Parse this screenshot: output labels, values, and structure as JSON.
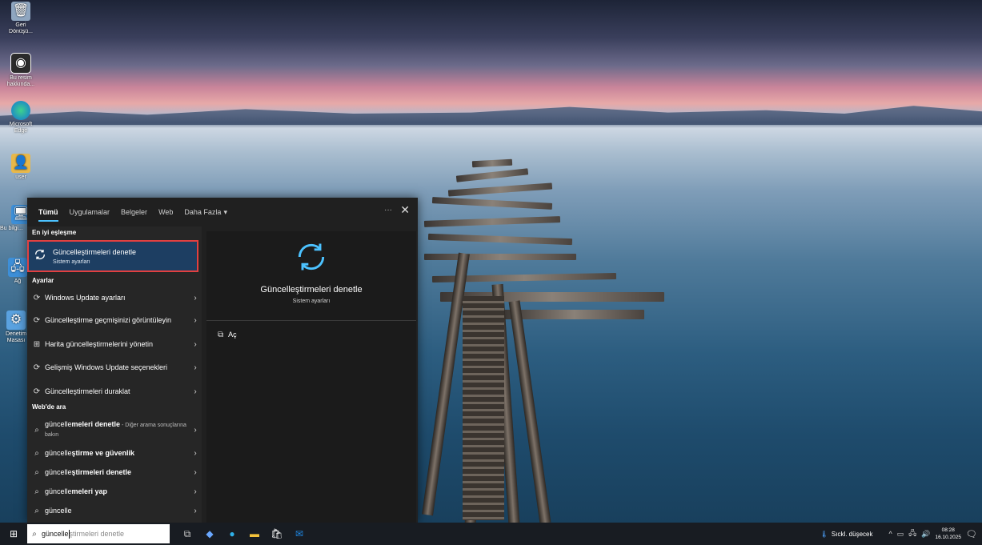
{
  "desktop": {
    "icons": [
      {
        "label": "Geri Dönüşü..."
      },
      {
        "label": "Bu resim hakkında..."
      },
      {
        "label": "Microsoft Edge"
      },
      {
        "label": "user"
      },
      {
        "label": "Bu bilgi..."
      },
      {
        "label": "Ağ"
      },
      {
        "label": "Denetim Masası"
      }
    ]
  },
  "search_panel": {
    "tabs": [
      "Tümü",
      "Uygulamalar",
      "Belgeler",
      "Web",
      "Daha Fazla"
    ],
    "more_options": "···",
    "close": "✕",
    "best_match_heading": "En iyi eşleşme",
    "best_match": {
      "title": "Güncelleştirmeleri denetle",
      "subtitle": "Sistem ayarları"
    },
    "settings_heading": "Ayarlar",
    "settings_items": [
      {
        "label": "Windows Update ayarları"
      },
      {
        "label": "Güncelleştirme geçmişinizi görüntüleyin"
      },
      {
        "label": "Harita güncelleştirmelerini yönetin"
      },
      {
        "label": "Gelişmiş Windows Update seçenekleri"
      },
      {
        "label": "Güncelleştirmeleri duraklat"
      }
    ],
    "web_heading": "Web'de ara",
    "web_items": [
      {
        "prefix": "güncelle",
        "bold": "meleri denetle",
        "suffix": " - Diğer arama sonuçlarına bakın"
      },
      {
        "prefix": "güncelle",
        "bold": "ştirme ve güvenlik",
        "suffix": ""
      },
      {
        "prefix": "güncelle",
        "bold": "ştirmeleri denetle",
        "suffix": ""
      },
      {
        "prefix": "güncelle",
        "bold": "meleri yap",
        "suffix": ""
      },
      {
        "prefix": "güncelle",
        "bold": "",
        "suffix": ""
      }
    ],
    "preview": {
      "title": "Güncelleştirmeleri denetle",
      "subtitle": "Sistem ayarları",
      "open_label": "Aç"
    }
  },
  "taskbar": {
    "search_typed": "güncelle",
    "search_hint": "ştirmeleri denetle",
    "weather": "Sıckl. düşecek",
    "time": "08:28",
    "date": "16.10.2025"
  },
  "colors": {
    "accent": "#4cc2ff",
    "highlight_border": "#e24040",
    "best_bg": "#1d3e62"
  }
}
